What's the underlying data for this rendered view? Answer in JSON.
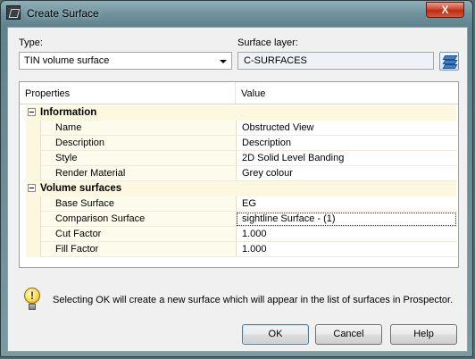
{
  "window": {
    "title": "Create Surface",
    "close_glyph": "X"
  },
  "form": {
    "type_label": "Type:",
    "type_value": "TIN volume surface",
    "layer_label": "Surface layer:",
    "layer_value": "C-SURFACES"
  },
  "grid": {
    "headers": [
      "Properties",
      "Value"
    ],
    "categories": [
      {
        "name": "Information",
        "rows": [
          {
            "property": "Name",
            "value": "Obstructed  View"
          },
          {
            "property": "Description",
            "value": "Description"
          },
          {
            "property": "Style",
            "value": "2D Solid Level Banding"
          },
          {
            "property": "Render Material",
            "value": "Grey colour"
          }
        ]
      },
      {
        "name": "Volume surfaces",
        "rows": [
          {
            "property": "Base Surface",
            "value": "EG"
          },
          {
            "property": "Comparison Surface",
            "value": "sightline Surface - (1)"
          },
          {
            "property": "Cut Factor",
            "value": "1.000"
          },
          {
            "property": "Fill Factor",
            "value": "1.000"
          }
        ]
      }
    ]
  },
  "hint": {
    "icon": "lightbulb-icon",
    "glyph": "!",
    "text": "Selecting OK will create a new surface which will appear in the list of surfaces in Prospector."
  },
  "buttons": {
    "ok": "OK",
    "cancel": "Cancel",
    "help": "Help"
  }
}
